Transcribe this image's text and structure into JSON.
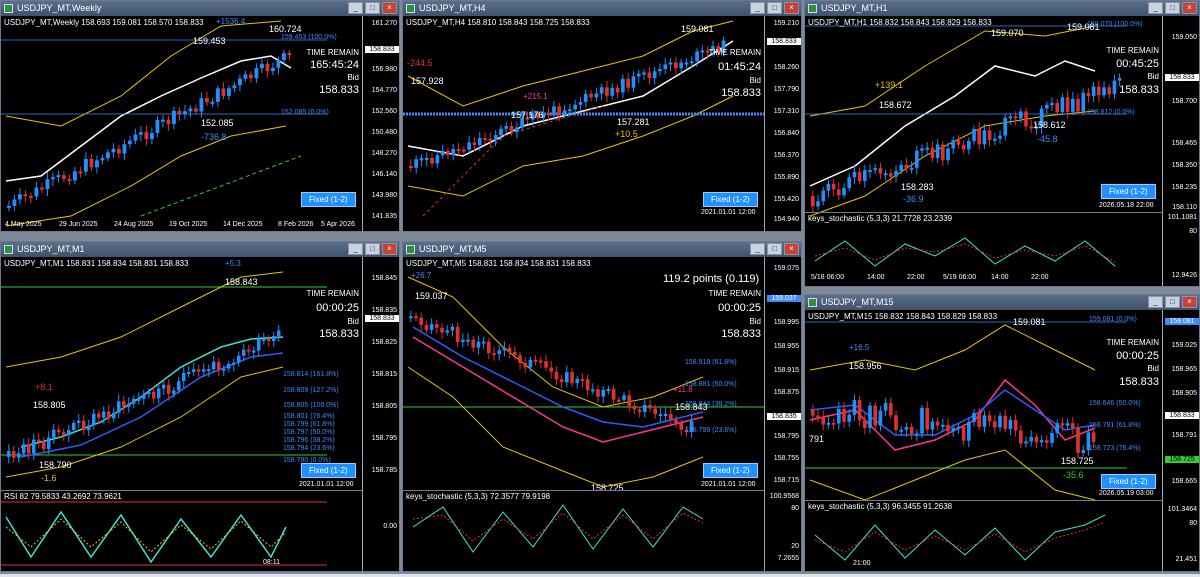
{
  "colors": {
    "bull": "#1e90ff",
    "bear": "#e03030",
    "ma_white": "#ffffff",
    "ma_yellow": "#e8c400",
    "fib": "#3d8bff",
    "green": "#33cc33",
    "teal": "#40e0d0",
    "magenta": "#ff3399"
  },
  "icons": {
    "app": "chart-window-icon",
    "min": "minimize-icon",
    "max": "maximize-icon",
    "close": "close-icon"
  },
  "window_buttons": {
    "min": "_",
    "max": "□",
    "close": "×"
  },
  "weekly": {
    "title": "USDJPY_MT,Weekly",
    "header": "USDJPY_MT,Weekly  158.693 159.081 158.570 158.833",
    "time_remain_label": "TIME REMAIN",
    "time_remain": "165:45:24",
    "bid_label": "Bid",
    "bid": "158.833",
    "fixed": "Fixed (1-2)",
    "labels": {
      "a": "159.453",
      "b": "160.724",
      "c": "152.085",
      "d": "-736.8",
      "e": "+1536.4"
    },
    "fib": [
      "159.453 (100.0%)",
      "152.085 (0.0%)"
    ],
    "axis": [
      "161.270",
      "158.833",
      "156.980",
      "154.770",
      "152.560",
      "150.480",
      "148.270",
      "146.140",
      "143.980",
      "141.835"
    ],
    "dates": [
      "4 May 2025",
      "29 Jun 2025",
      "24 Aug 2025",
      "19 Oct 2025",
      "14 Dec 2025",
      "8 Feb 2026",
      "5 Apr 2026"
    ]
  },
  "h4": {
    "title": "USDJPY_MT,H4",
    "header": "USDJPY_MT,H4  158.810 158.843 158.725 158.833",
    "time_remain_label": "TIME REMAIN",
    "time_remain": "01:45:24",
    "bid_label": "Bid",
    "bid": "158.833",
    "fixed": "Fixed (1-2)",
    "stamp": "2021.01.01 12:00",
    "labels": {
      "a": "159.081",
      "b": "157.928",
      "c": "-244.5",
      "d": "157.176",
      "e": "157.281",
      "f": "+10.5",
      "g": "+215.1"
    },
    "axis": [
      "159.210",
      "158.833",
      "158.260",
      "157.790",
      "157.310",
      "156.840",
      "156.370",
      "155.890",
      "155.420",
      "154.940"
    ]
  },
  "h1": {
    "title": "USDJPY_MT,H1",
    "header": "USDJPY_MT,H1  158.832 158.843 158.829 158.833",
    "time_remain_label": "TIME REMAIN",
    "time_remain": "00:45:25",
    "bid_label": "Bid",
    "bid": "158.833",
    "fixed": "Fixed (1-2)",
    "stamp": "2026.05.18 22:00",
    "labels": {
      "a": "159.070",
      "b": "159.081",
      "c": "158.672",
      "d": "+139.1",
      "e": "158.612",
      "f": "-45.8",
      "g": "158.283",
      "h": "-36.9"
    },
    "fib": [
      "159.070 (100.0%)",
      "158.612 (0.0%)"
    ],
    "axis": [
      "159.050",
      "158.833",
      "158.700",
      "158.465",
      "158.350",
      "158.235",
      "158.110"
    ],
    "stoch": "keys_stochastic (5,3,3) 21.7728 23.2339",
    "stoch_axis": [
      "101.1081",
      "80",
      "12.9426"
    ],
    "times": [
      "5/18 06:00",
      "14:00",
      "22:00",
      "5/19 06:00",
      "14:00",
      "22:00"
    ]
  },
  "m1": {
    "title": "USDJPY_MT,M1",
    "header": "USDJPY_MT,M1  158.831 158.834 158.831 158.833",
    "time_remain_label": "TIME REMAIN",
    "time_remain": "00:00:25",
    "bid_label": "Bid",
    "bid": "158.833",
    "fixed": "Fixed (1-2)",
    "stamp": "2021.01.01 12:00",
    "labels": {
      "a": "158.843",
      "b": "158.805",
      "c": "158.790",
      "d": "+8.1",
      "e": "-1.6",
      "f": "+5.3"
    },
    "fib": [
      "158.814 (161.8%)",
      "158.809 (127.2%)",
      "158.805 (100.0%)",
      "158.801 (76.4%)",
      "158.799 (61.8%)",
      "158.797 (50.0%)",
      "158.796 (38.2%)",
      "158.794 (23.6%)",
      "158.790 (0.0%)"
    ],
    "axis": [
      "158.845",
      "158.835",
      "158.833",
      "158.825",
      "158.815",
      "158.805",
      "158.795",
      "158.785"
    ],
    "sub": "RSI 82 79.5833 43.2692 73.9621",
    "sub_axis": [
      "0.00"
    ],
    "time": "08:11"
  },
  "m5": {
    "title": "USDJPY_MT,M5",
    "header": "USDJPY_MT,M5  158.831 158.834 158.831 158.833",
    "points": "119.2 points (0.119)",
    "time_remain_label": "TIME REMAIN",
    "time_remain": "00:00:25",
    "bid_label": "Bid",
    "bid": "158.833",
    "fixed": "Fixed (1-2)",
    "stamp": "2021.01.01 12:00",
    "labels": {
      "a": "159.037",
      "b": "158.843",
      "c": "158.725",
      "d": "+26.7",
      "e": "+11.8"
    },
    "fib": [
      "158.918 (61.8%)",
      "158.881 (50.0%)",
      "158.844 (38.2%)",
      "158.799 (23.6%)"
    ],
    "axis": [
      "159.075",
      "159.037",
      "158.995",
      "158.955",
      "158.915",
      "158.875",
      "158.835",
      "158.795",
      "158.755",
      "158.715"
    ],
    "stoch": "keys_stochastic (5,3,3) 72.3577 79.9198",
    "stoch_axis": [
      "100.9568",
      "80",
      "20",
      "7.2655"
    ]
  },
  "m15": {
    "title": "USDJPY_MT,M15",
    "header": "USDJPY_MT,M15  158.832 158.843 158.829 158.833",
    "time_remain_label": "TIME REMAIN",
    "time_remain": "00:00:25",
    "bid_label": "Bid",
    "bid": "158.833",
    "fixed": "Fixed (1-2)",
    "stamp": "2026.05.19 03:00",
    "labels": {
      "a": "159.081",
      "b": "158.956",
      "c": "158.725",
      "d": "+16.5",
      "e": "-35.6",
      "f": "791"
    },
    "fib": [
      "159.081 (0.0%)",
      "158.646 (50.0%)",
      "158.791 (61.8%)",
      "158.723 (76.4%)"
    ],
    "axis": [
      "159.081",
      "159.025",
      "158.965",
      "158.905",
      "158.833",
      "158.791",
      "158.725",
      "158.665"
    ],
    "stoch": "keys_stochastic (5,3,3) 96.3455 91.2638",
    "stoch_axis": [
      "101.3464",
      "80",
      "21.451"
    ],
    "time": "21:00"
  }
}
